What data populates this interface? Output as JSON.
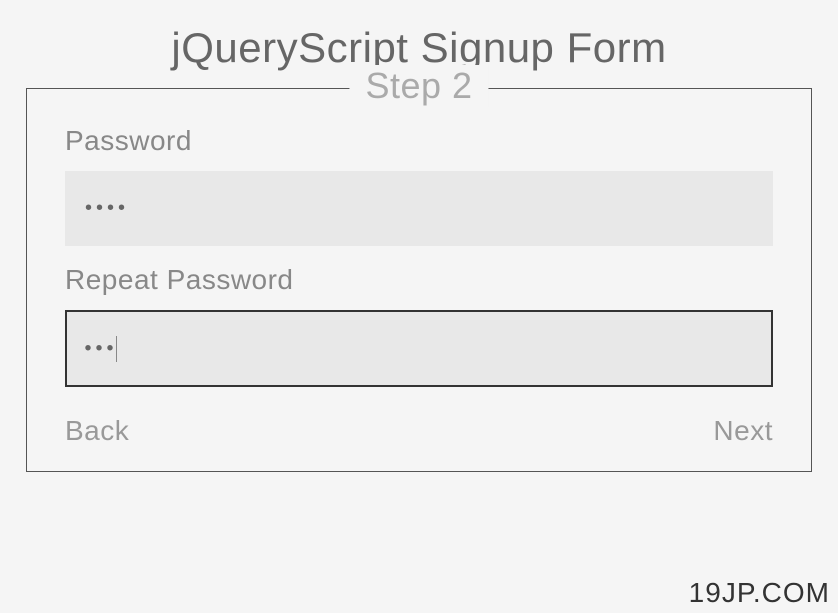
{
  "title": "jQueryScript Signup Form",
  "step_label": "Step 2",
  "fields": {
    "password": {
      "label": "Password",
      "value": "••••"
    },
    "repeat_password": {
      "label": "Repeat Password",
      "value": "•••"
    }
  },
  "buttons": {
    "back": "Back",
    "next": "Next"
  },
  "watermark": "19JP.COM"
}
